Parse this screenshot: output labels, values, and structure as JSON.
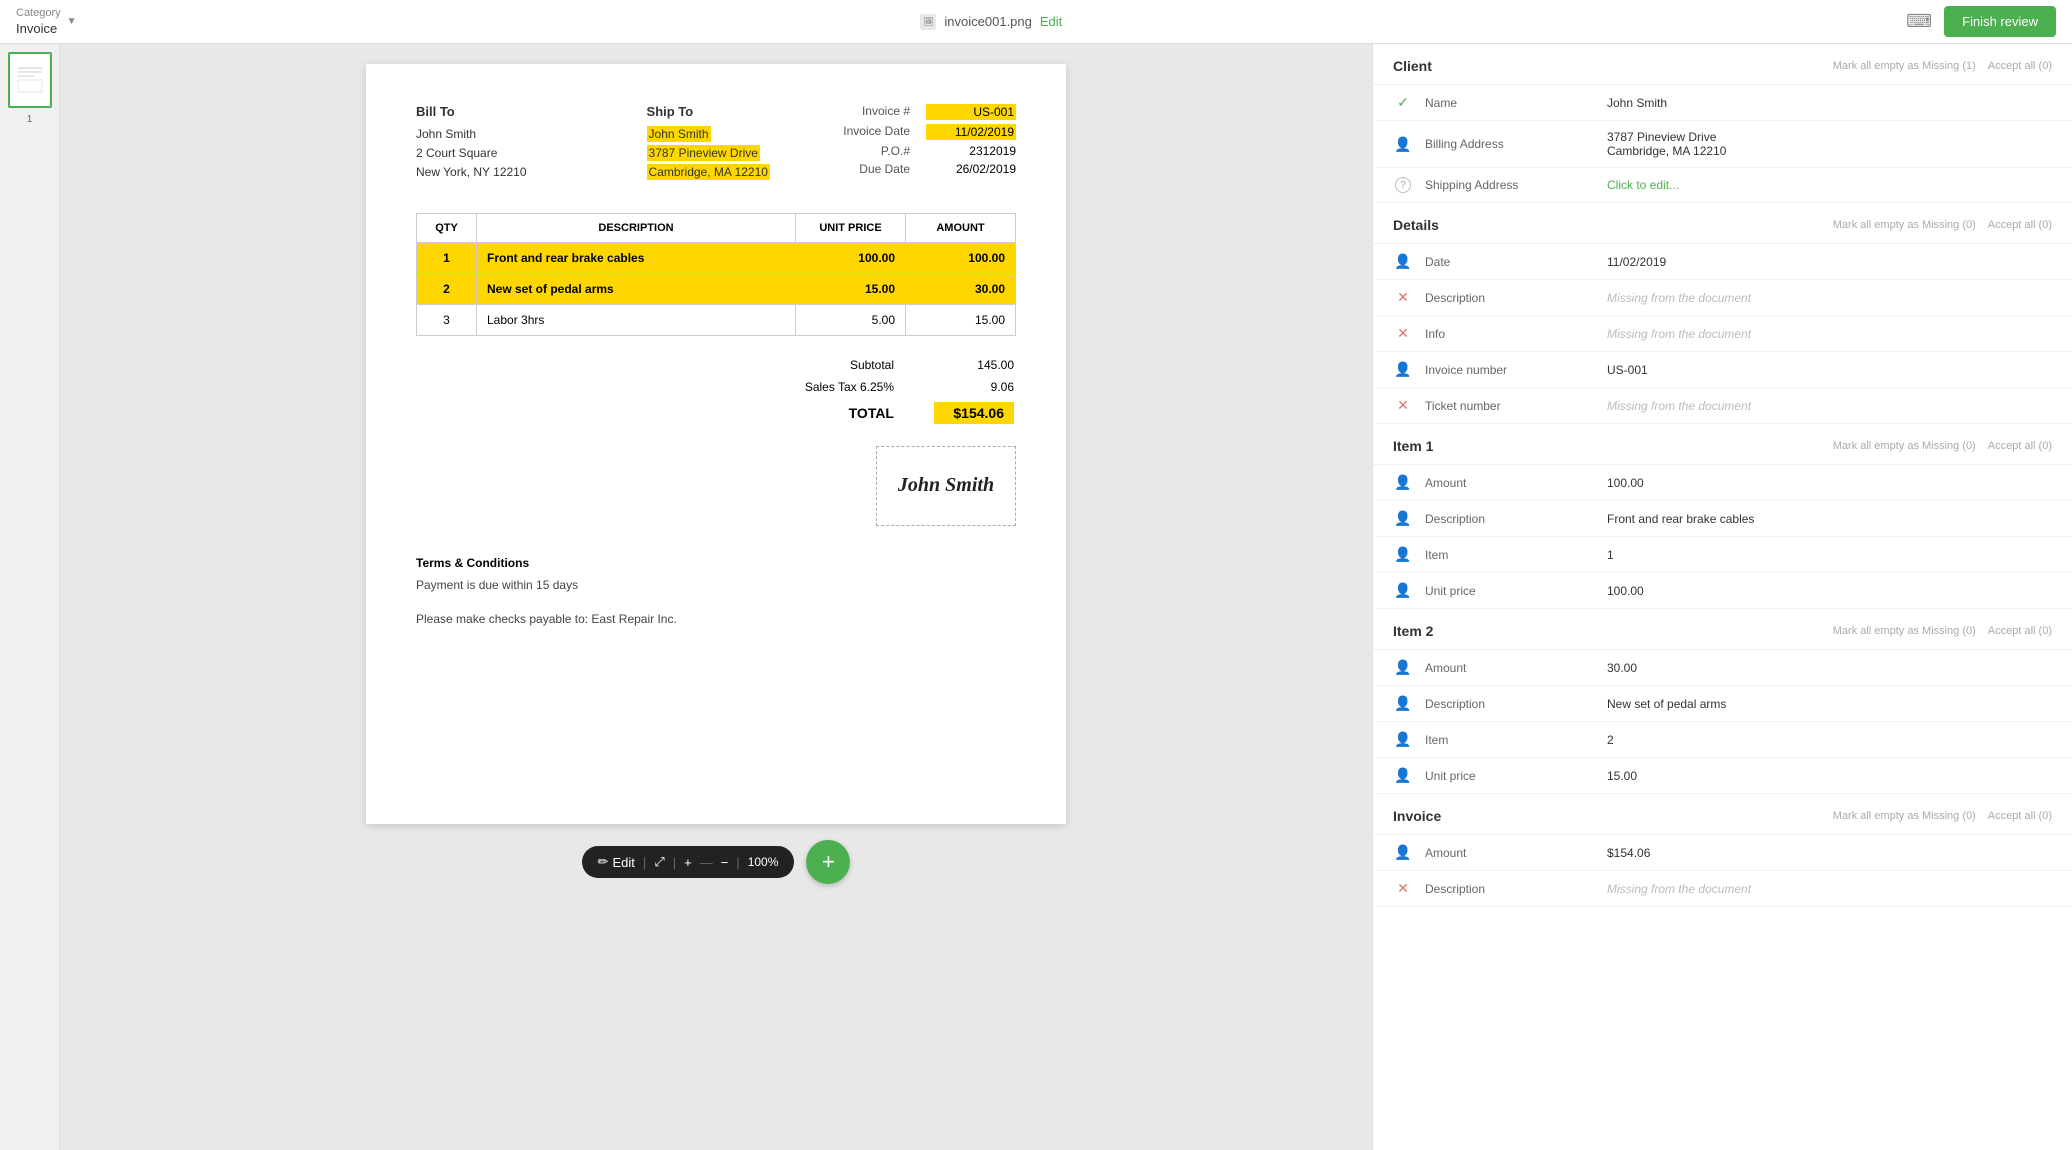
{
  "app": {
    "category_label": "Category",
    "category_value": "Invoice",
    "filename": "invoice001.png",
    "edit_label": "Edit",
    "finish_review_label": "Finish review"
  },
  "toolbar": {
    "edit_label": "Edit",
    "expand_icon": "⤢",
    "plus_icon": "+",
    "minus_icon": "−",
    "zoom": "100%"
  },
  "invoice": {
    "bill_to_label": "Bill To",
    "bill_name": "John Smith",
    "bill_address1": "2 Court Square",
    "bill_address2": "New York, NY 12210",
    "ship_to_label": "Ship To",
    "ship_name": "John Smith",
    "ship_address1": "3787 Pineview Drive",
    "ship_address2": "Cambridge, MA 12210",
    "invoice_num_label": "Invoice #",
    "invoice_num": "US-001",
    "invoice_date_label": "Invoice Date",
    "invoice_date": "11/02/2019",
    "po_label": "P.O.#",
    "po_value": "2312019",
    "due_date_label": "Due Date",
    "due_date": "26/02/2019",
    "table": {
      "headers": [
        "QTY",
        "DESCRIPTION",
        "UNIT PRICE",
        "AMOUNT"
      ],
      "rows": [
        {
          "qty": "1",
          "desc": "Front and rear brake cables",
          "unit": "100.00",
          "amount": "100.00",
          "highlight": true
        },
        {
          "qty": "2",
          "desc": "New set of pedal arms",
          "unit": "15.00",
          "amount": "30.00",
          "highlight": true
        },
        {
          "qty": "3",
          "desc": "Labor 3hrs",
          "unit": "5.00",
          "amount": "15.00",
          "highlight": false
        }
      ]
    },
    "subtotal_label": "Subtotal",
    "subtotal": "145.00",
    "tax_label": "Sales Tax 6.25%",
    "tax": "9.06",
    "total_label": "TOTAL",
    "total": "$154.06",
    "terms_heading": "Terms & Conditions",
    "terms_line1": "Payment is due within 15 days",
    "terms_line2": "Please make checks payable to: East Repair Inc."
  },
  "right_panel": {
    "client_section": {
      "title": "Client",
      "mark_missing_label": "Mark all empty as Missing (1)",
      "accept_all_label": "Accept all (0)",
      "fields": [
        {
          "icon": "check",
          "label": "Name",
          "value": "John Smith",
          "missing": false
        },
        {
          "icon": "person",
          "label": "Billing Address",
          "value": "3787 Pineview Drive\nCambridge, MA 12210",
          "missing": false,
          "multiline": true,
          "value1": "3787 Pineview Drive",
          "value2": "Cambridge, MA 12210"
        },
        {
          "icon": "question",
          "label": "Shipping Address",
          "value": "Click to edit...",
          "clickable": true
        }
      ]
    },
    "details_section": {
      "title": "Details",
      "mark_missing_label": "Mark all empty as Missing (0)",
      "accept_all_label": "Accept all (0)",
      "fields": [
        {
          "icon": "person",
          "label": "Date",
          "value": "11/02/2019"
        },
        {
          "icon": "x",
          "label": "Description",
          "value": "Missing from the document",
          "missing": true
        },
        {
          "icon": "x",
          "label": "Info",
          "value": "Missing from the document",
          "missing": true
        },
        {
          "icon": "person",
          "label": "Invoice number",
          "value": "US-001"
        },
        {
          "icon": "x",
          "label": "Ticket number",
          "value": "Missing from the document",
          "missing": true
        }
      ]
    },
    "item1_section": {
      "title": "Item 1",
      "mark_missing_label": "Mark all empty as Missing (0)",
      "accept_all_label": "Accept all (0)",
      "fields": [
        {
          "icon": "person",
          "label": "Amount",
          "value": "100.00"
        },
        {
          "icon": "person",
          "label": "Description",
          "value": "Front and rear brake cables"
        },
        {
          "icon": "person",
          "label": "Item",
          "value": "1"
        },
        {
          "icon": "person",
          "label": "Unit price",
          "value": "100.00"
        }
      ]
    },
    "item2_section": {
      "title": "Item 2",
      "mark_missing_label": "Mark all empty as Missing (0)",
      "accept_all_label": "Accept all (0)",
      "fields": [
        {
          "icon": "person",
          "label": "Amount",
          "value": "30.00"
        },
        {
          "icon": "person",
          "label": "Description",
          "value": "New set of pedal arms"
        },
        {
          "icon": "person",
          "label": "Item",
          "value": "2"
        },
        {
          "icon": "person",
          "label": "Unit price",
          "value": "15.00"
        }
      ]
    },
    "invoice_section": {
      "title": "Invoice",
      "mark_missing_label": "Mark all empty as Missing (0)",
      "accept_all_label": "Accept all (0)",
      "fields": [
        {
          "icon": "person",
          "label": "Amount",
          "value": "$154.06"
        },
        {
          "icon": "x",
          "label": "Description",
          "value": "Missing from the document",
          "missing": true
        }
      ]
    }
  }
}
